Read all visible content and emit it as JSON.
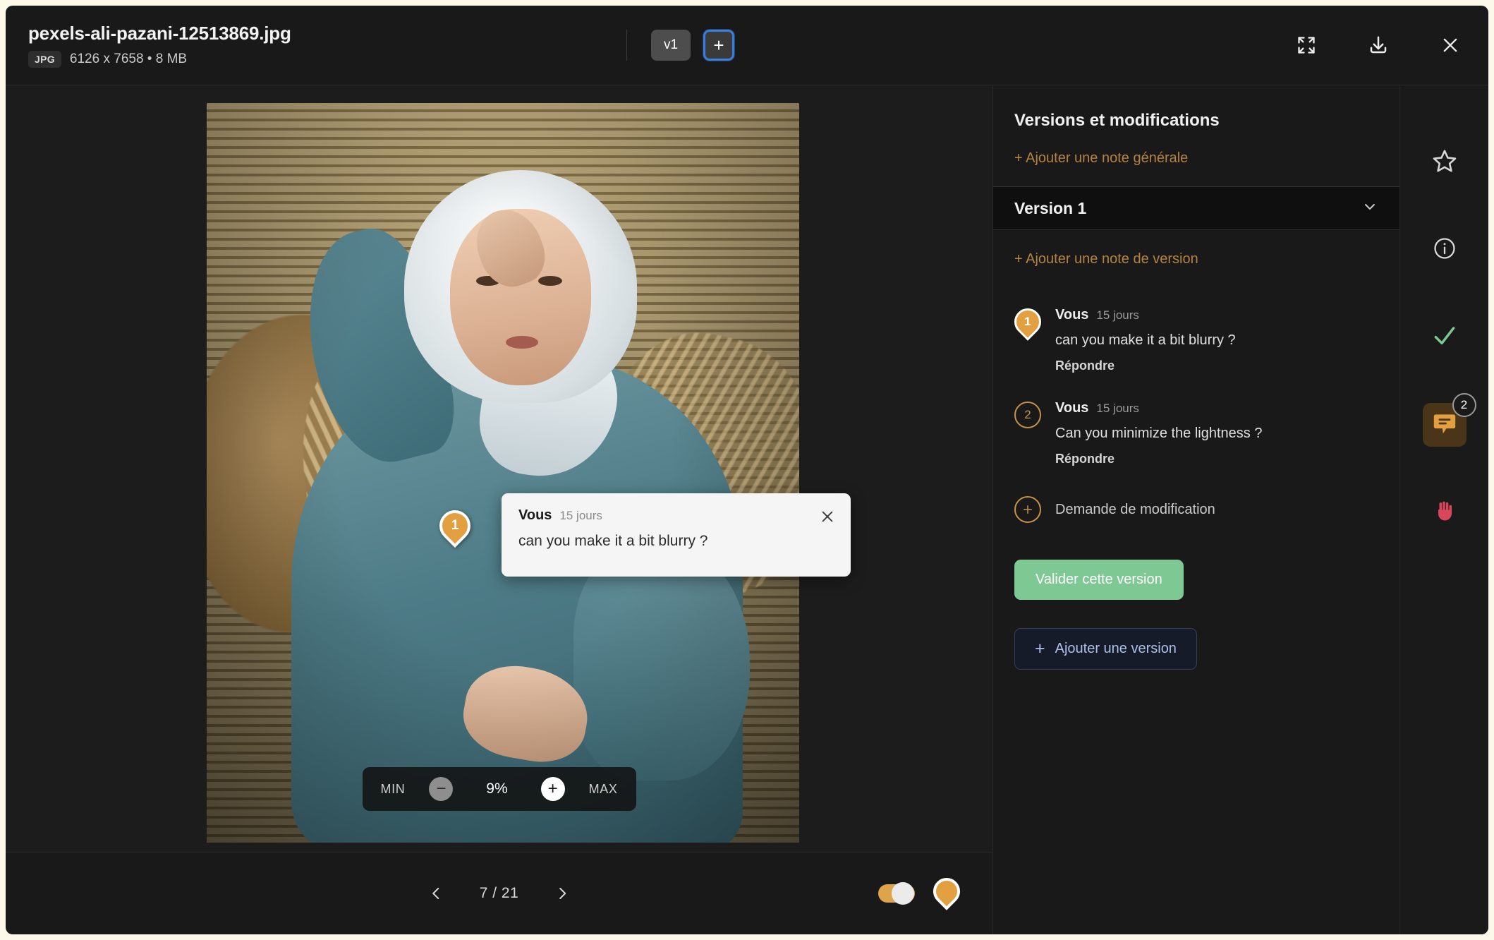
{
  "header": {
    "file_name": "pexels-ali-pazani-12513869.jpg",
    "file_type_badge": "JPG",
    "file_dimensions": "6126 x 7658  •  8 MB",
    "version_tab": "v1",
    "add_version_tab": "+",
    "fullscreen_icon": "fullscreen-icon",
    "download_icon": "download-icon",
    "close_icon": "close-icon"
  },
  "stage": {
    "pin": {
      "number": "1"
    },
    "popup": {
      "author": "Vous",
      "time": "15 jours",
      "text": "can you make it a bit blurry ?",
      "close_icon": "close-icon"
    },
    "zoom": {
      "min_label": "MIN",
      "minus_label": "−",
      "value": "9%",
      "plus_label": "+",
      "max_label": "MAX"
    }
  },
  "bottom": {
    "prev_icon": "chevron-left-icon",
    "page_count": "7 / 21",
    "next_icon": "chevron-right-icon",
    "toggle_name": "comments-visibility-toggle",
    "avatar_name": "user-pin-avatar"
  },
  "sidebar": {
    "title": "Versions et modifications",
    "add_general_note": "+ Ajouter une note générale",
    "version_header": "Version 1",
    "version_chevron": "chevron-down-icon",
    "add_version_note": "+ Ajouter une note de version",
    "comments": [
      {
        "marker": "1",
        "marker_style": "pin",
        "author": "Vous",
        "time": "15 jours",
        "text": "can you make it a bit blurry ?",
        "reply": "Répondre"
      },
      {
        "marker": "2",
        "marker_style": "circle",
        "author": "Vous",
        "time": "15 jours",
        "text": "Can you minimize the lightness ?",
        "reply": "Répondre"
      }
    ],
    "modification_request": "Demande de modification",
    "validate_button": "Valider cette version",
    "add_version_button": "Ajouter une version",
    "add_version_plus": "+"
  },
  "rail": {
    "star_icon": "star-icon",
    "info_icon": "info-icon",
    "check_icon": "check-icon",
    "comment_icon": "comment-icon",
    "comment_badge": "2",
    "hand_icon": "hand-icon"
  },
  "colors": {
    "accent_orange": "#e3a040",
    "link_orange": "#b58340",
    "validate_green": "#7ec894",
    "focus_blue": "#3b7ddd",
    "hand_red": "#d9455a"
  }
}
